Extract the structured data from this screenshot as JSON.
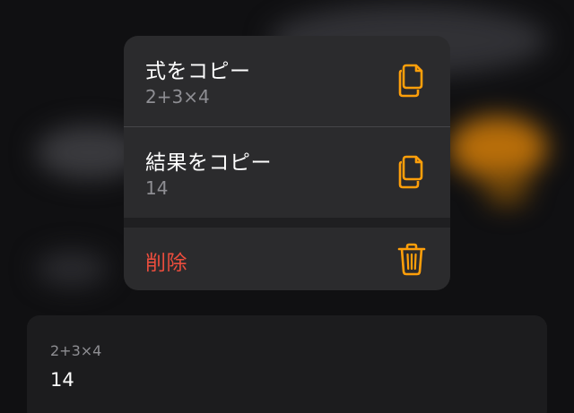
{
  "menu": {
    "items": [
      {
        "label": "式をコピー",
        "sublabel": "2+3×4",
        "icon": "copy-icon"
      },
      {
        "label": "結果をコピー",
        "sublabel": "14",
        "icon": "copy-icon"
      },
      {
        "label": "削除",
        "icon": "trash-icon"
      }
    ]
  },
  "history_card": {
    "expression": "2+3×4",
    "result": "14"
  },
  "colors": {
    "accent": "#ff9f0a",
    "destructive": "#eb4d3d",
    "menu_background": "#2b2b2d",
    "secondary_text": "#8e8e93"
  }
}
